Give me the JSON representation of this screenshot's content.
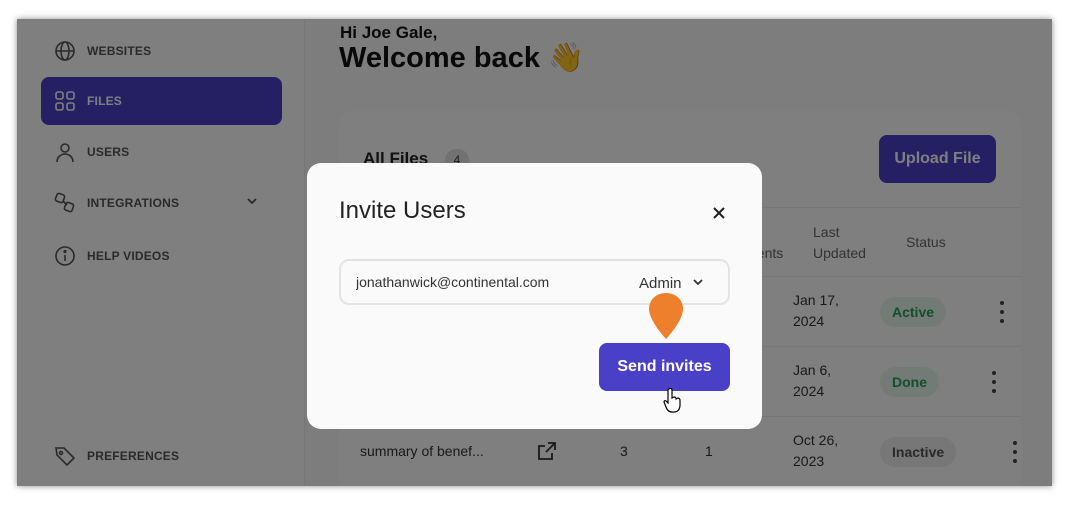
{
  "sidebar": {
    "items": [
      {
        "label": "WEBSITES",
        "icon": "globe-icon"
      },
      {
        "label": "FILES",
        "icon": "grid-icon"
      },
      {
        "label": "USERS",
        "icon": "user-icon"
      },
      {
        "label": "INTEGRATIONS",
        "icon": "integrations-icon"
      },
      {
        "label": "HELP VIDEOS",
        "icon": "info-icon"
      }
    ],
    "preferences": {
      "label": "PREFERENCES",
      "icon": "tag-icon"
    }
  },
  "main": {
    "greeting": "Hi Joe Gale,",
    "welcome": "Welcome back 👋",
    "files_card": {
      "title": "All Files",
      "count": "4",
      "upload_label": "Upload File",
      "columns": [
        "nents",
        "Last Updated",
        "Status"
      ],
      "rows": [
        {
          "name": "",
          "pages": "",
          "comments": "",
          "updated": "Jan 17, 2024",
          "status": "Active"
        },
        {
          "name": "",
          "pages": "",
          "comments": "",
          "updated": "Jan 6, 2024",
          "status": "Done"
        },
        {
          "name": "summary of benef...",
          "pages": "3",
          "comments": "1",
          "updated": "Oct 26, 2023",
          "status": "Inactive"
        }
      ]
    }
  },
  "modal": {
    "title": "Invite Users",
    "email_value": "jonathanwick@continental.com",
    "role_value": "Admin",
    "send_label": "Send invites"
  },
  "colors": {
    "accent": "#4a3fc7",
    "pin": "#ee7f2d"
  }
}
